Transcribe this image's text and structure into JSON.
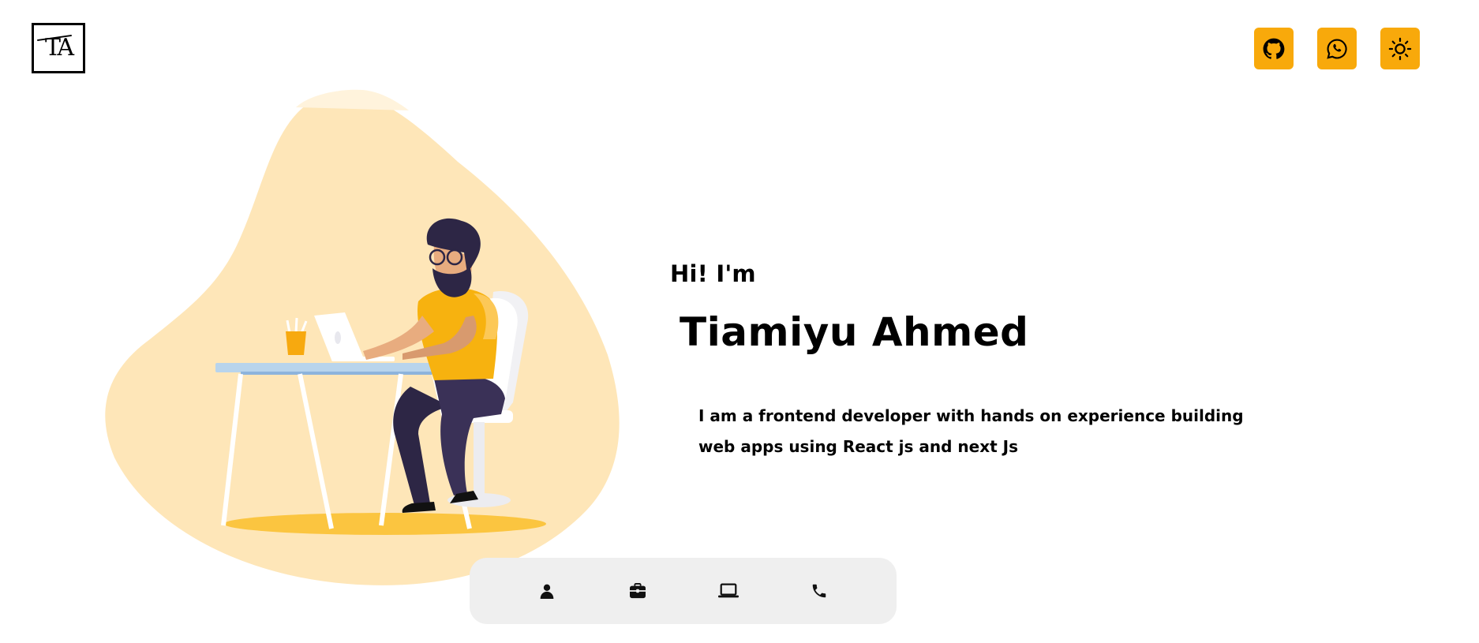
{
  "header": {
    "logo": {
      "text": "TA"
    },
    "social": [
      {
        "name": "github-icon"
      },
      {
        "name": "whatsapp-icon"
      }
    ],
    "theme_toggle": {
      "icon": "sun-icon"
    }
  },
  "hero": {
    "greeting": "Hi! I'm",
    "name": "Tiamiyu Ahmed",
    "bio": "I am a frontend developer with hands on experience building web apps using React js and next Js"
  },
  "bottom_nav": {
    "items": [
      {
        "icon": "person-icon"
      },
      {
        "icon": "briefcase-icon"
      },
      {
        "icon": "laptop-icon"
      },
      {
        "icon": "phone-icon"
      }
    ]
  },
  "colors": {
    "accent": "#f8a90b",
    "blob": "#fee6b8",
    "nav_bg": "#efefef"
  }
}
